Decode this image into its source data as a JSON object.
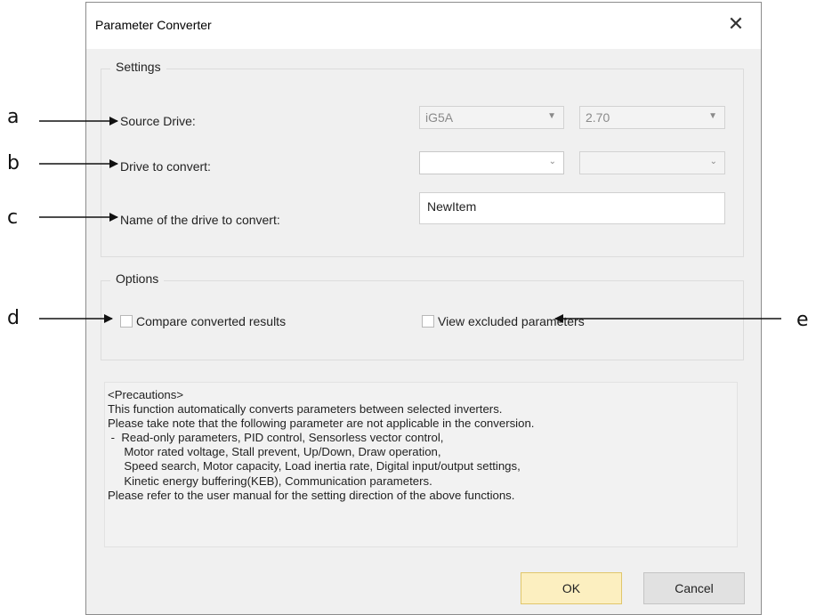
{
  "dialog": {
    "title": "Parameter Converter",
    "close_glyph": "✕"
  },
  "settings": {
    "legend": "Settings",
    "source_drive_label": "Source Drive:",
    "source_drive_value": "iG5A",
    "source_version_value": "2.70",
    "drive_to_convert_label": "Drive to convert:",
    "drive_to_convert_value": "",
    "drive_to_convert_version_value": "",
    "name_label": "Name of the drive to convert:",
    "name_value": "NewItem"
  },
  "options": {
    "legend": "Options",
    "compare_label": "Compare converted results",
    "compare_checked": false,
    "view_excluded_label": "View excluded parameters",
    "view_excluded_checked": false
  },
  "precautions": {
    "lines": [
      "<Precautions>",
      "This function automatically converts parameters between selected inverters.",
      "Please take note that the following parameter are not applicable in the conversion.",
      " -  Read-only parameters, PID control, Sensorless vector control,",
      "     Motor rated voltage, Stall prevent, Up/Down, Draw operation,",
      "     Speed search, Motor capacity, Load inertia rate, Digital input/output settings,",
      "     Kinetic energy buffering(KEB), Communication parameters.",
      "Please refer to the user manual for the setting direction of the above functions."
    ]
  },
  "buttons": {
    "ok_label": "OK",
    "cancel_label": "Cancel"
  },
  "callouts": {
    "a": "a",
    "b": "b",
    "c": "c",
    "d": "d",
    "e": "e"
  },
  "icons": {
    "dropdown": "chevron-down-icon",
    "close": "close-icon"
  },
  "colors": {
    "ok_button_bg": "#fcefc0",
    "dialog_bg": "#f0f0f0"
  }
}
